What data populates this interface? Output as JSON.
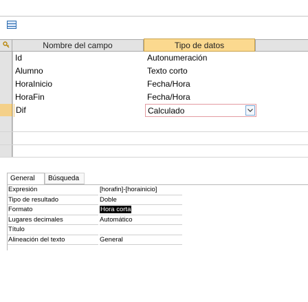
{
  "design_grid": {
    "headers": {
      "field_name": "Nombre del campo",
      "data_type": "Tipo de datos"
    },
    "rows": [
      {
        "name": "Id",
        "type": "Autonumeración",
        "primary_key": true
      },
      {
        "name": "Alumno",
        "type": "Texto corto"
      },
      {
        "name": "HoraInicio",
        "type": "Fecha/Hora"
      },
      {
        "name": "HoraFin",
        "type": "Fecha/Hora"
      },
      {
        "name": "Dif",
        "type": "Calculado",
        "active": true
      }
    ]
  },
  "property_tabs": {
    "general": "General",
    "lookup": "Búsqueda"
  },
  "properties": [
    {
      "label": "Expresión",
      "value": "[horafin]-[horainicio]"
    },
    {
      "label": "Tipo de resultado",
      "value": "Doble"
    },
    {
      "label": "Formato",
      "value": "Hora corta",
      "highlighted": true
    },
    {
      "label": "Lugares decimales",
      "value": "Automático"
    },
    {
      "label": "Título",
      "value": ""
    },
    {
      "label": "Alineación del texto",
      "value": "General"
    }
  ],
  "colors": {
    "selected_header": "#fbd98f",
    "accent_border": "#e39aa0"
  },
  "icons": {
    "table": "table-icon",
    "key": "key-icon",
    "dropdown": "chevron-down-icon"
  }
}
